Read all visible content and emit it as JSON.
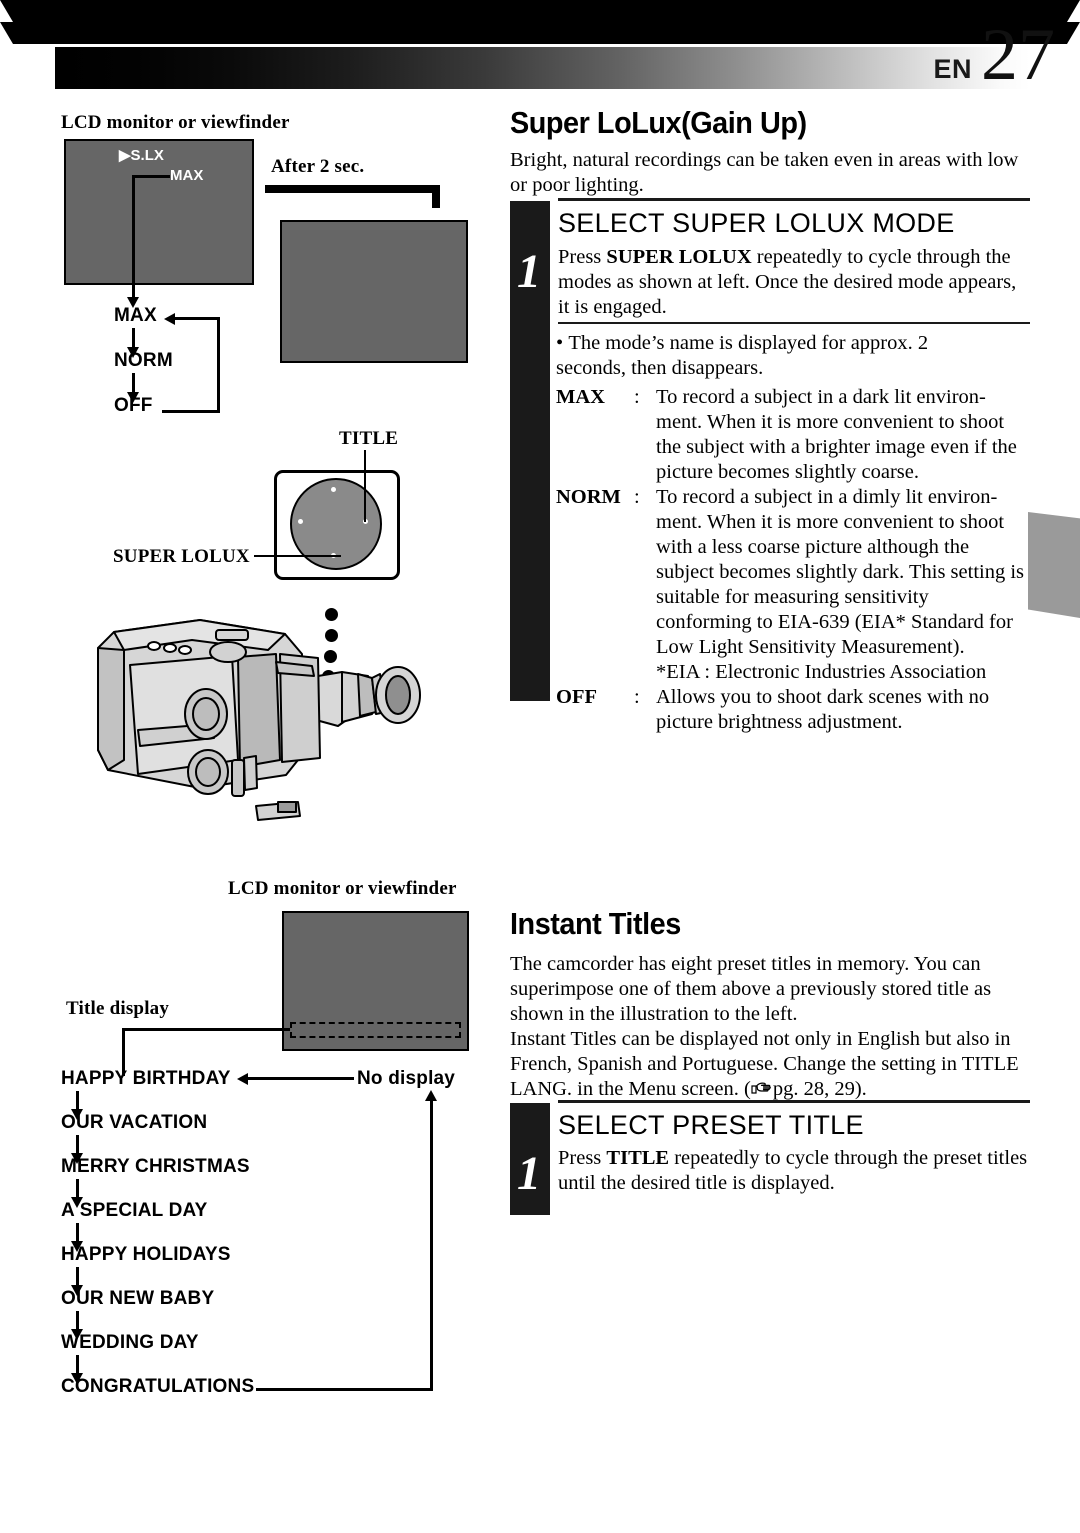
{
  "header": {
    "lang_code": "EN",
    "page_number": "27"
  },
  "left_top_diagram": {
    "caption": "LCD monitor or viewfinder",
    "screen1": {
      "indicator": "▶S.LX",
      "mode_label": "MAX"
    },
    "after_label": "After 2 sec.",
    "cycle": [
      "MAX",
      "NORM",
      "OFF"
    ]
  },
  "button_callout": {
    "title_label": "TITLE",
    "superlolux_label": "SUPER LOLUX"
  },
  "left_bottom_diagram": {
    "caption": "LCD monitor or viewfinder",
    "title_display_label": "Title display",
    "no_display_label": "No display",
    "titles": [
      "HAPPY BIRTHDAY",
      "OUR VACATION",
      "MERRY CHRISTMAS",
      "A SPECIAL DAY",
      "HAPPY HOLIDAYS",
      "OUR NEW BABY",
      "WEDDING DAY",
      "CONGRATULATIONS"
    ]
  },
  "section_superlolux": {
    "heading": "Super LoLux(Gain Up)",
    "intro": "Bright, natural recordings can be taken even in areas with low or poor lighting.",
    "step": {
      "number": "1",
      "title": "SELECT SUPER LOLUX MODE",
      "body_pre": "Press ",
      "body_bold": "SUPER LOLUX",
      "body_post": " repeatedly to cycle through the modes as shown at left. Once the desired mode appears, it is engaged."
    },
    "bullet": "The mode’s name is displayed for approx. 2 seconds, then disappears.",
    "definitions": [
      {
        "key": "MAX",
        "colon": ":",
        "value": "To record a subject in a dark lit environ-ment. When it is more convenient to shoot the subject with a brighter image even if the picture becomes slightly coarse."
      },
      {
        "key": "NORM",
        "colon": ":",
        "value": "To record a subject in a dimly lit environ-ment. When it is more convenient to shoot with a less coarse picture although the subject becomes slightly dark. This setting is suitable for measuring sensitivity conforming to EIA-639 (EIA* Standard for Low Light Sensitivity Measurement)."
      },
      {
        "key": "",
        "colon": "",
        "value": "*EIA : Electronic Industries Association"
      },
      {
        "key": "OFF",
        "colon": ":",
        "value": "Allows you to shoot dark scenes with no picture brightness adjustment."
      }
    ]
  },
  "section_instant_titles": {
    "heading": "Instant Titles",
    "para1": "The camcorder has eight preset titles in memory. You can superimpose one of them above a previously stored title as shown in the illustration to the left.",
    "para2_a": "Instant Titles can be displayed not only in English but also in French, Spanish and Portuguese. Change the setting in TITLE LANG. in the Menu screen. (",
    "para2_ref": "pg. 28, 29).",
    "step": {
      "number": "1",
      "title": "SELECT PRESET TITLE",
      "body_pre": "Press ",
      "body_bold": "TITLE",
      "body_post": " repeatedly to cycle through the preset titles until the desired title is displayed."
    }
  },
  "colors": {
    "screen_gray": "#666666",
    "tab_gray": "#9a9a9a",
    "step_bar": "#1a1a1a"
  }
}
